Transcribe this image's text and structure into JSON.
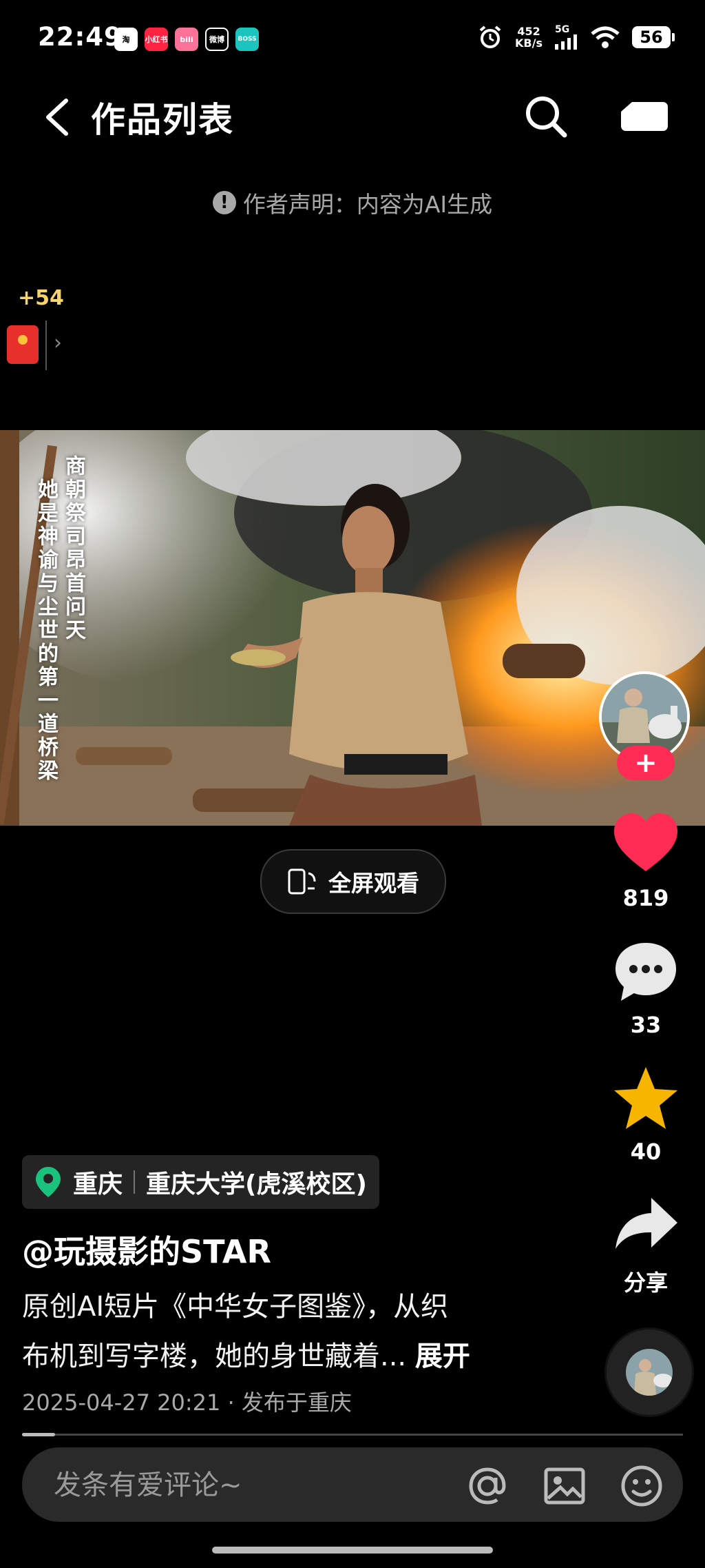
{
  "status_bar": {
    "time": "22:49",
    "app_badges": [
      {
        "label": "淘",
        "color": "#ff5000"
      },
      {
        "label": "小红书",
        "color": "#ff2442"
      },
      {
        "label": "bili",
        "color": "#fb7299"
      },
      {
        "label": "微博",
        "color": "#000000"
      },
      {
        "label": "BOSS",
        "color": "#1bc5bd"
      }
    ],
    "net_speed_value": "452",
    "net_speed_unit": "KB/s",
    "network_type": "5G",
    "battery": "56"
  },
  "header": {
    "title": "作品列表"
  },
  "ai_notice": "作者声明：内容为AI生成",
  "red_packet": {
    "plus": "+54"
  },
  "video": {
    "poem_right": "商朝祭司昂首问天",
    "poem_left": "她是神谕与尘世的第一道桥梁"
  },
  "fullscreen_label": "全屏观看",
  "side_rail": {
    "likes": "819",
    "comments": "33",
    "favorites": "40",
    "share_label": "分享"
  },
  "location": {
    "city": "重庆",
    "place": "重庆大学(虎溪校区)"
  },
  "author": "@玩摄影的STAR",
  "description": {
    "line1": "原创AI短片《中华女子图鉴》，从织",
    "line2": "布机到写字楼，她的身世藏着...",
    "expand": "展开"
  },
  "meta": "2025-04-27 20:21 · 发布于重庆",
  "progress": 0.05,
  "comment": {
    "placeholder": "发条有爱评论~"
  },
  "colors": {
    "like": "#fe2c55",
    "favorite": "#f7b500",
    "location_pin": "#19c37d"
  }
}
